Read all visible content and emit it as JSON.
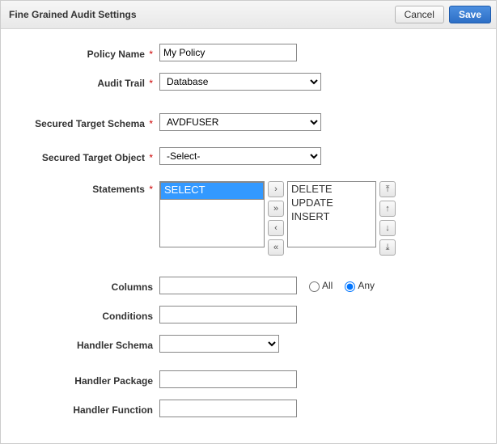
{
  "header": {
    "title": "Fine Grained Audit Settings",
    "cancel": "Cancel",
    "save": "Save"
  },
  "form": {
    "policyName": {
      "label": "Policy Name",
      "required": true,
      "value": "My Policy"
    },
    "auditTrail": {
      "label": "Audit Trail",
      "required": true,
      "value": "Database"
    },
    "schema": {
      "label": "Secured Target Schema",
      "required": true,
      "value": "AVDFUSER"
    },
    "object": {
      "label": "Secured Target Object",
      "required": true,
      "value": "-Select-"
    },
    "statements": {
      "label": "Statements",
      "required": true,
      "available": [
        "SELECT"
      ],
      "selected": [
        "DELETE",
        "UPDATE",
        "INSERT"
      ],
      "availableHighlighted": "SELECT"
    },
    "columns": {
      "label": "Columns",
      "value": "",
      "radio": {
        "all": "All",
        "any": "Any",
        "checked": "any"
      }
    },
    "conditions": {
      "label": "Conditions",
      "value": ""
    },
    "handlerSchema": {
      "label": "Handler Schema",
      "value": ""
    },
    "handlerPackage": {
      "label": "Handler Package",
      "value": ""
    },
    "handlerFunction": {
      "label": "Handler Function",
      "value": ""
    }
  },
  "icons": {
    "moveRight": "›",
    "moveAllRight": "»",
    "moveLeft": "‹",
    "moveAllLeft": "«",
    "top": "⤒",
    "up": "↑",
    "down": "↓",
    "bottom": "⤓"
  }
}
